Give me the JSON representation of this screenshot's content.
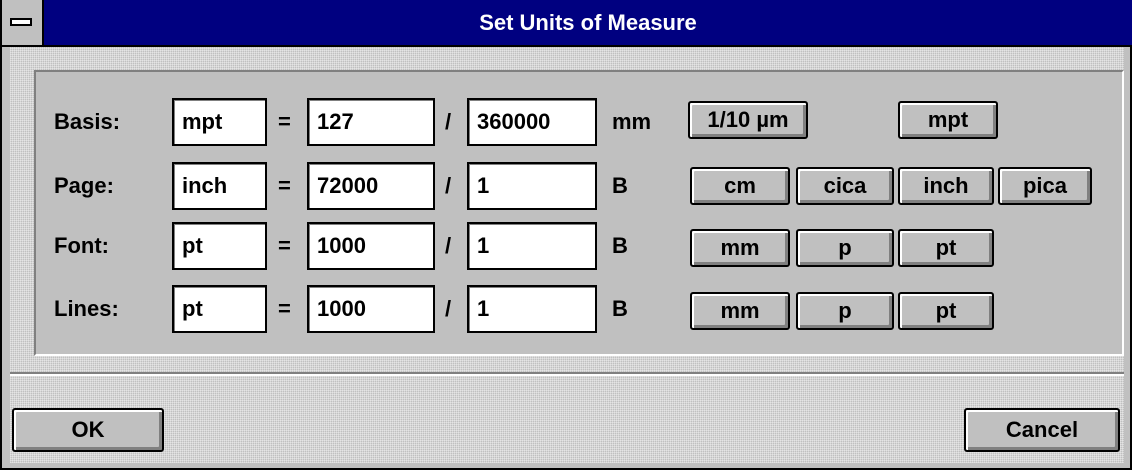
{
  "window": {
    "title": "Set Units of Measure"
  },
  "rows": [
    {
      "label": "Basis:",
      "unit_name": "mpt",
      "eq": "=",
      "numerator": "127",
      "slash": "/",
      "denominator": "360000",
      "unit": "mm",
      "buttons": [
        "1/10 µm",
        "mpt"
      ]
    },
    {
      "label": "Page:",
      "unit_name": "inch",
      "eq": "=",
      "numerator": "72000",
      "slash": "/",
      "denominator": "1",
      "unit": "B",
      "buttons": [
        "cm",
        "cica",
        "inch",
        "pica"
      ]
    },
    {
      "label": "Font:",
      "unit_name": "pt",
      "eq": "=",
      "numerator": "1000",
      "slash": "/",
      "denominator": "1",
      "unit": "B",
      "buttons": [
        "mm",
        "p",
        "pt"
      ]
    },
    {
      "label": "Lines:",
      "unit_name": "pt",
      "eq": "=",
      "numerator": "1000",
      "slash": "/",
      "denominator": "1",
      "unit": "B",
      "buttons": [
        "mm",
        "p",
        "pt"
      ]
    }
  ],
  "footer": {
    "ok_label": "OK",
    "cancel_label": "Cancel"
  },
  "colors": {
    "titlebar": "#000080",
    "face": "#c0c0c0",
    "field": "#ffffff"
  }
}
